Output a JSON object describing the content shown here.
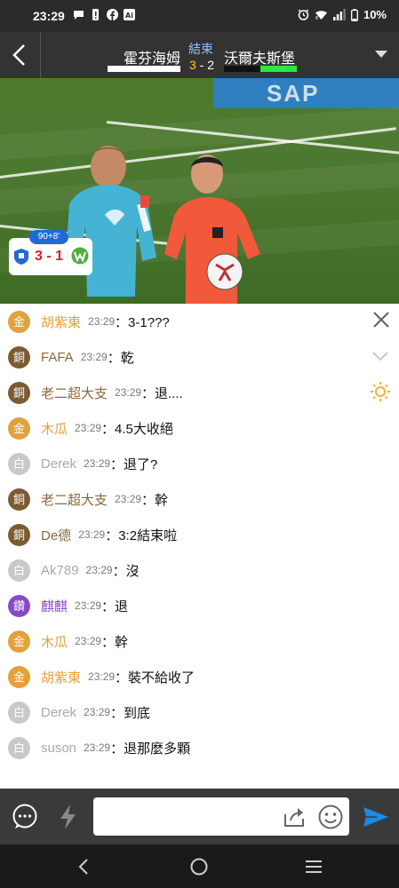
{
  "status_bar": {
    "time": "23:29",
    "battery": "10%"
  },
  "match": {
    "home_team": "霍芬海姆",
    "away_team": "沃爾夫斯堡",
    "status": "結束",
    "home_score": "3",
    "score_sep": " - ",
    "away_score": "2",
    "away_bar_fraction": 0.5
  },
  "live_overlay": {
    "minute": "90+8'",
    "score": "3 - 1"
  },
  "video": {
    "ad_text": "SAP"
  },
  "chat": {
    "messages": [
      {
        "rank": "金",
        "rank_level": "gold",
        "user": "胡紫東",
        "time": "23:29",
        "text": "：3-1???"
      },
      {
        "rank": "銅",
        "rank_level": "bronze",
        "user": "FAFA",
        "time": "23:29",
        "text": "：乾"
      },
      {
        "rank": "銅",
        "rank_level": "bronze",
        "user": "老二超大支",
        "time": "23:29",
        "text": "：退...."
      },
      {
        "rank": "金",
        "rank_level": "gold",
        "user": "木瓜",
        "time": "23:29",
        "text": "：4.5大收絕"
      },
      {
        "rank": "白",
        "rank_level": "white",
        "user": "Derek",
        "time": "23:29",
        "text": "：退了?"
      },
      {
        "rank": "銅",
        "rank_level": "bronze",
        "user": "老二超大支",
        "time": "23:29",
        "text": "：幹"
      },
      {
        "rank": "銅",
        "rank_level": "bronze",
        "user": "De德",
        "time": "23:29",
        "text": "：3:2結束啦"
      },
      {
        "rank": "白",
        "rank_level": "white",
        "user": "Ak789",
        "time": "23:29",
        "text": "：沒"
      },
      {
        "rank": "鑽",
        "rank_level": "diamond",
        "user": "麒麒",
        "time": "23:29",
        "text": "：退"
      },
      {
        "rank": "金",
        "rank_level": "gold",
        "user": "木瓜",
        "time": "23:29",
        "text": "：幹"
      },
      {
        "rank": "金",
        "rank_level": "gold",
        "user": "胡紫東",
        "time": "23:29",
        "text": "：裝不給收了"
      },
      {
        "rank": "白",
        "rank_level": "white",
        "user": "Derek",
        "time": "23:29",
        "text": "：到底"
      },
      {
        "rank": "白",
        "rank_level": "white",
        "user": "suson",
        "time": "23:29",
        "text": "：退那麼多顆"
      }
    ]
  },
  "input": {
    "value": "",
    "placeholder": ""
  },
  "colors": {
    "gold": "#e3a13c",
    "bronze": "#7b5b32",
    "white": "#c9c9c9",
    "diamond": "#8849c9",
    "send": "#1e88e5",
    "away_bar": "#2ee44b",
    "home_score": "#ffd000"
  },
  "icons": {
    "status_left": [
      "chat-bubble-icon",
      "phone-alert-icon",
      "facebook-icon",
      "ai-icon"
    ],
    "status_right": [
      "alarm-icon",
      "wifi-icon",
      "signal-icon",
      "battery-icon"
    ],
    "header": [
      "back-arrow-icon",
      "dropdown-triangle-icon"
    ],
    "chat": [
      "close-icon",
      "collapse-chevron-icon",
      "brightness-icon"
    ],
    "input": [
      "chat-bubble-icon",
      "lightning-icon",
      "share-icon",
      "emoji-icon",
      "send-icon"
    ],
    "nav": [
      "nav-back-icon",
      "nav-home-icon",
      "nav-recents-icon"
    ]
  }
}
